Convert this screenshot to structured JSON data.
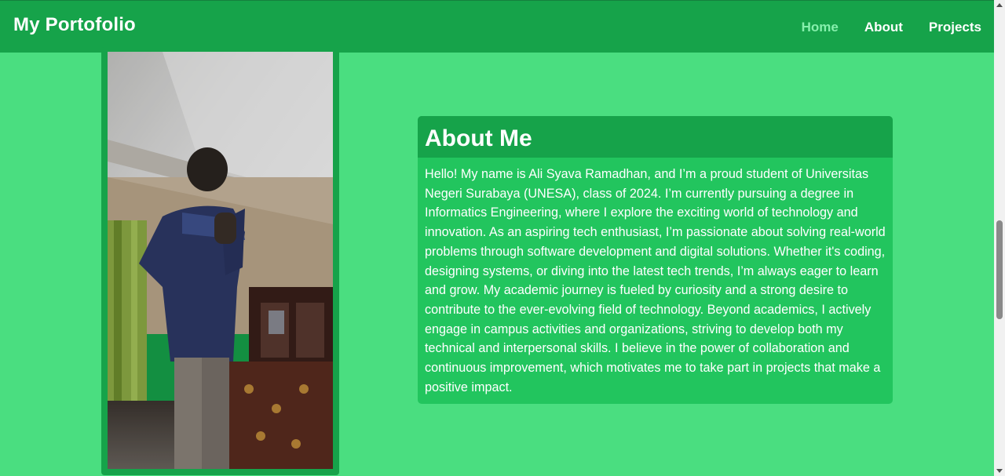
{
  "header": {
    "brand": "My Portofolio",
    "nav": [
      {
        "label": "Home",
        "active": true
      },
      {
        "label": "About",
        "active": false
      },
      {
        "label": "Projects",
        "active": false
      }
    ]
  },
  "about": {
    "title": "About Me",
    "text": "Hello! My name is Ali Syava Ramadhan, and I’m a proud student of Universitas Negeri Surabaya (UNESA), class of 2024. I’m currently pursuing a degree in Informatics Engineering, where I explore the exciting world of technology and innovation. As an aspiring tech enthusiast, I’m passionate about solving real-world problems through software development and digital solutions. Whether it's coding, designing systems, or diving into the latest tech trends, I’m always eager to learn and grow. My academic journey is fueled by curiosity and a strong desire to contribute to the ever-evolving field of technology. Beyond academics, I actively engage in campus activities and organizations, striving to develop both my technical and interpersonal skills. I believe in the power of collaboration and continuous improvement, which motivates me to take part in projects that make a positive impact."
  },
  "colors": {
    "page_bg": "#4ade80",
    "navbar_bg": "#16a34a",
    "active_link": "#86efac",
    "card_bg": "#22c55e",
    "card_header_bg": "#16a34a"
  },
  "icons": {
    "scroll_up": "chevron-up-icon",
    "scroll_down": "chevron-down-icon"
  }
}
